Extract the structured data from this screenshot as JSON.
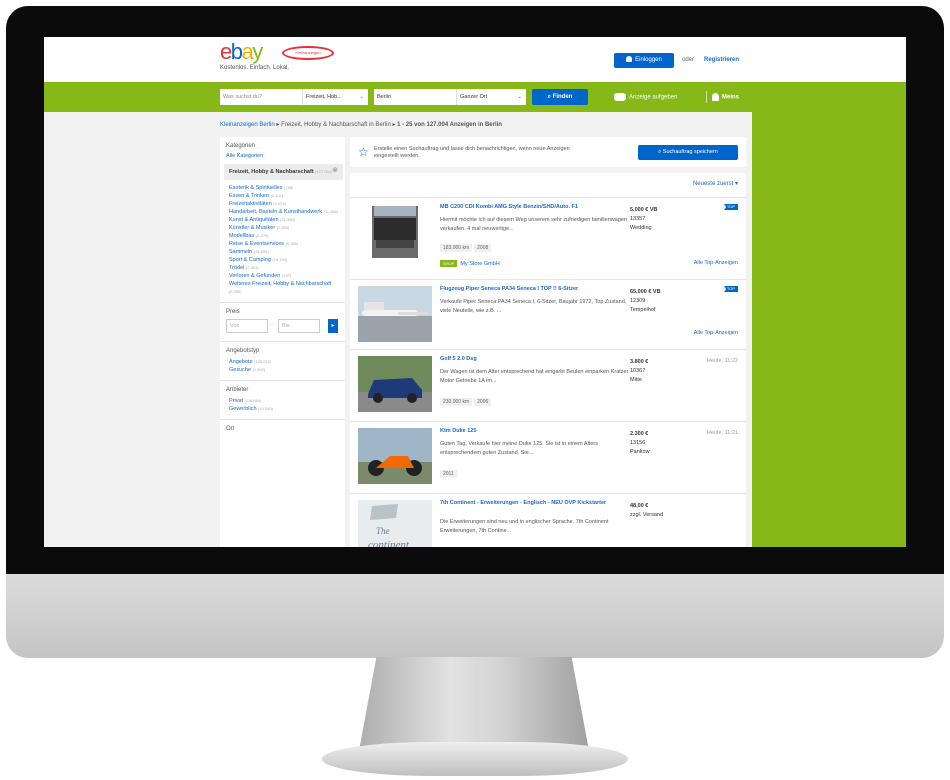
{
  "header": {
    "logo_text": "ebay",
    "logo_badge": "Kleinanzeigen",
    "tagline": "Kostenlos. Einfach. Lokal.",
    "login_label": "Einloggen",
    "or_text": "oder",
    "register_label": "Registrieren"
  },
  "search": {
    "query_placeholder": "Was suchst du?",
    "category_value": "Freizeit, Hob...",
    "location_value": "Berlin",
    "radius_value": "Ganzer Ort",
    "find_label": "Finden",
    "post_ad_label": "Anzeige aufgeben",
    "my_menu_label": "Meins"
  },
  "breadcrumb": {
    "root": "Kleinanzeigen Berlin",
    "current": "Freizeit, Hobby & Nachbarschaft in Berlin",
    "result_count": "1 - 25 von 127.004 Anzeigen in Berlin"
  },
  "sidebar": {
    "categories_title": "Kategorien",
    "all_categories": "Alle Kategorien",
    "active_category": "Freizeit, Hobby & Nachbarschaft",
    "active_count": "(127.004)",
    "items": [
      {
        "label": "Esoterik & Spirituelles",
        "count": "(798)"
      },
      {
        "label": "Essen & Trinken",
        "count": "(2.101)"
      },
      {
        "label": "Freizeitaktivitäten",
        "count": "(4.924)"
      },
      {
        "label": "Handarbeit, Basteln & Kunsthandwerk",
        "count": "(11.458)"
      },
      {
        "label": "Kunst & Antiquitäten",
        "count": "(21.368)"
      },
      {
        "label": "Künstler & Musiker",
        "count": "(2.860)"
      },
      {
        "label": "Modellbau",
        "count": "(5.279)"
      },
      {
        "label": "Reise & Eventservices",
        "count": "(6.365)"
      },
      {
        "label": "Sammeln",
        "count": "(34.598)"
      },
      {
        "label": "Sport & Camping",
        "count": "(16.194)"
      },
      {
        "label": "Trödel",
        "count": "(7.403)"
      },
      {
        "label": "Verloren & Gefunden",
        "count": "(167)"
      },
      {
        "label": "Weiteres Freizeit, Hobby & Nachbarschaft",
        "count": "(8.095)"
      }
    ],
    "price_title": "Preis",
    "price_from": "Von",
    "price_to": "Bis",
    "offer_type_title": "Angebotstyp",
    "offer_items": [
      {
        "label": "Angebote",
        "count": "(125.012)"
      },
      {
        "label": "Gesuche",
        "count": "(1.992)"
      }
    ],
    "provider_title": "Anbieter",
    "provider_items": [
      {
        "label": "Privat",
        "count": "(116.664)"
      },
      {
        "label": "Gewerblich",
        "count": "(10.340)"
      }
    ],
    "location_title": "Ort"
  },
  "alert": {
    "text": "Erstelle einen Suchauftrag und lasse dich benachrichtigen, wenn neue Anzeigen eingestellt werden.",
    "save_label": "Suchauftrag speichern"
  },
  "sort_label": "Neueste zuerst",
  "listings": [
    {
      "title": "MB C200 CDI Kombi AMG Style Benzin/SHD/Auto. F1",
      "desc": "Hiermit möchte ich auf diesem Weg unserem sehr zufriedigen familienwagen verkaufen. 4 mal neuwertige...",
      "tags": [
        "183.000 km",
        "2008"
      ],
      "price": "5.000 € VB",
      "zip": "13357",
      "district": "Wedding",
      "top": "TOP",
      "store": "My Store GmbH",
      "store_badge": "SHOP",
      "all_top": "Alle Top-Anzeigen"
    },
    {
      "title": "Flugzeug Piper Seneca PA34 Seneca I TOP !! 6-Sitzer",
      "desc": "Verkaufe Piper Seneca PA34 Seneca I, 6-Sitzer, Baujahr 1972, Top Zustand, viele Neuteile, wie z.B. ...",
      "tags": [],
      "price": "65.000 € VB",
      "zip": "12309",
      "district": "Tempelhof",
      "top": "TOP",
      "all_top": "Alle Top-Anzeigen"
    },
    {
      "title": "Golf 5 2.0 Dsg",
      "desc": "Der Wagen ist dem Alter entsprechend hat eingarbt Beulen einparken Kratzer Motor Getriebe 1A im...",
      "tags": [
        "230.000 km",
        "2006"
      ],
      "price": "3.800 €",
      "zip": "10367",
      "district": "Mitte",
      "time": "Heute, 11:22"
    },
    {
      "title": "Ktm Duke 125",
      "desc": "Guten Tag, Verkaufe hier meine Duke 125. Sie ist in einem Alters entsprechendem guten Zustand. Sie...",
      "tags": [
        "2011"
      ],
      "price": "2.300 €",
      "zip": "13156",
      "district": "Pankow",
      "time": "Heute, 11:21"
    },
    {
      "title": "7th Continent - Erweiterungen - Englisch - NEU OVP Kickstarter",
      "desc": "Die Erweiterungen sind neu und in englischer Sprache. 7th Continent Erweiterungen, 7th Contine...",
      "tags": [],
      "price": "48,00 €",
      "zip": "zzgl. Versand",
      "district": ""
    }
  ],
  "colors": {
    "brand_green": "#86b817",
    "link_blue": "#1a68c7",
    "button_blue": "#0066cc"
  }
}
